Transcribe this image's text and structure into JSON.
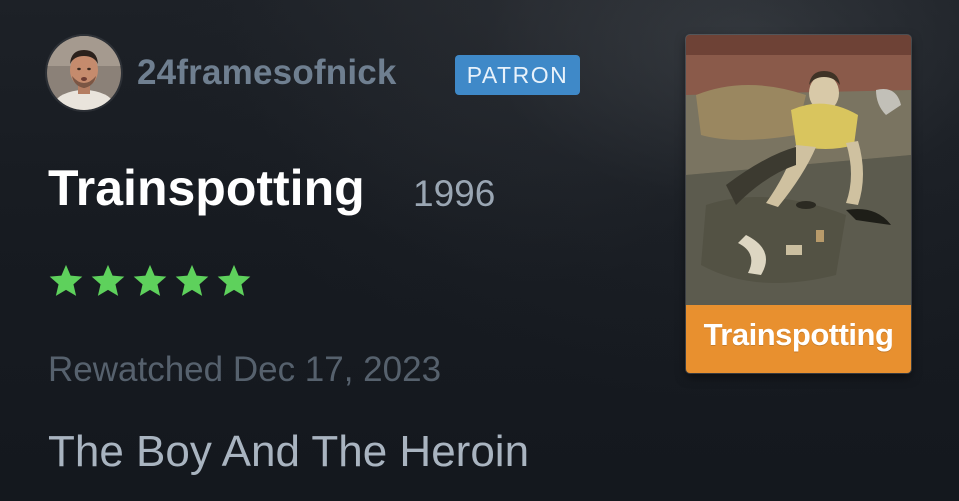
{
  "reviewer": {
    "username": "24framesofnick",
    "badge": "PATRON"
  },
  "film": {
    "title": "Trainspotting",
    "year": "1996",
    "poster_title": "Trainspotting"
  },
  "rating": {
    "stars": 5,
    "max_stars": 5,
    "color": "#5ed15c"
  },
  "log": {
    "date_text": "Rewatched Dec 17, 2023"
  },
  "review": {
    "text": "The Boy And The Heroin"
  },
  "colors": {
    "background": "#15191f",
    "badge": "#3f89c8",
    "poster_band": "#e8902f",
    "username": "#6f7f90"
  }
}
